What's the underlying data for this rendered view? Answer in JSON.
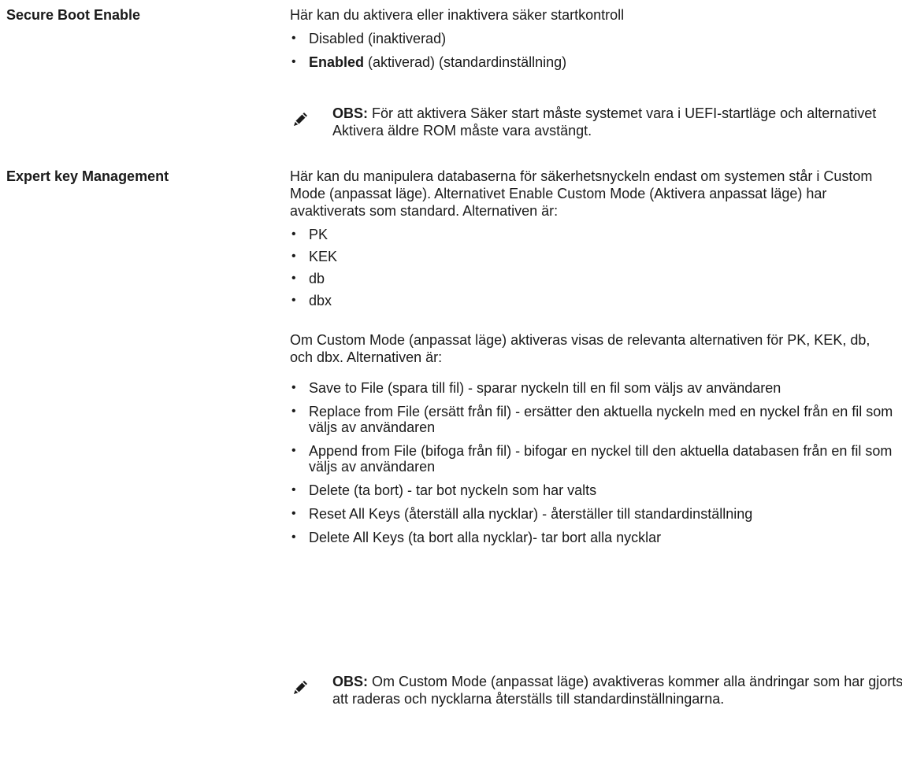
{
  "secure_boot": {
    "term": "Secure Boot Enable",
    "description": "Här kan du aktivera eller inaktivera säker startkontroll",
    "options": [
      {
        "bold": "",
        "text": "Disabled (inaktiverad)"
      },
      {
        "bold": "Enabled",
        "text": " (aktiverad) (standardinställning)"
      }
    ],
    "note": {
      "label": "OBS:",
      "text": " För att aktivera Säker start måste systemet vara i UEFI-startläge och alternativet Aktivera äldre ROM måste vara avstängt."
    }
  },
  "expert_key": {
    "term": "Expert key Management",
    "description": "Här kan du manipulera databaserna för säkerhetsnyckeln endast om systemen står i Custom Mode (anpassat läge). Alternativet Enable Custom Mode (Aktivera anpassat läge) har avaktiverats som standard. Alternativen är:",
    "keys": [
      "PK",
      "KEK",
      "db",
      "dbx"
    ],
    "custom_mode_text": "Om Custom Mode (anpassat läge) aktiveras visas de relevanta alternativen för PK, KEK, db, och dbx. Alternativen är:",
    "actions": [
      "Save to File (spara till fil) - sparar nyckeln till en fil som väljs av användaren",
      "Replace from File (ersätt från fil) - ersätter den aktuella nyckeln med en nyckel från en fil som väljs av användaren",
      "Append from File (bifoga från fil) - bifogar en nyckel till den aktuella databasen från en fil som väljs av användaren",
      "Delete (ta bort) - tar bot nyckeln som har valts",
      "Reset All Keys (återställ alla nycklar) - återställer till standardinställning",
      "Delete All Keys (ta bort alla nycklar)- tar bort alla nycklar"
    ],
    "note": {
      "label": "OBS:",
      "text": " Om Custom Mode (anpassat läge) avaktiveras kommer alla ändringar som har gjorts att raderas och nycklarna återställs till standardinställningarna."
    }
  }
}
